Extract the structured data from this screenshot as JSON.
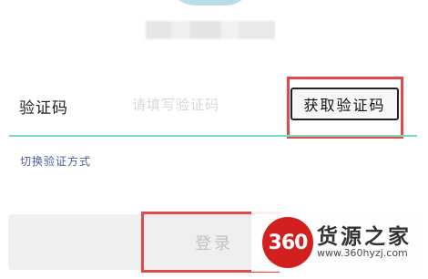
{
  "header": {
    "avatar_alt": "avatar"
  },
  "verification": {
    "label": "验证码",
    "placeholder": "请填写验证码",
    "get_code_label": "获取验证码"
  },
  "switch_method_label": "切换验证方式",
  "login_button_label": "登录",
  "watermark": {
    "number": "360",
    "title": "货源之家",
    "url": "www.360hyzj.com"
  },
  "colors": {
    "accent_underline": "#7BD9B6",
    "highlight_box": "#E04A4A",
    "watermark_red": "#D21F1F",
    "link": "#4A5AA8"
  }
}
